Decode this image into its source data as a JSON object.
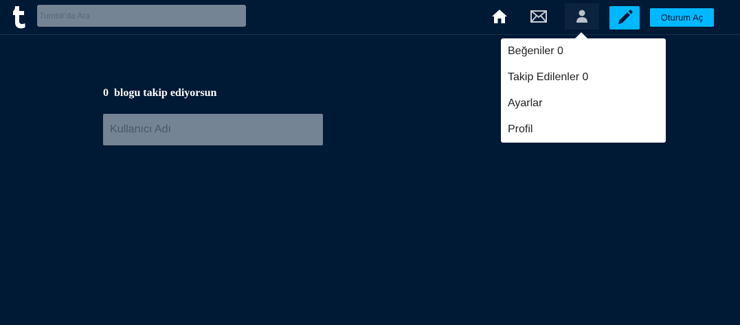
{
  "header": {
    "logo_icon": "tumblr-t-logo",
    "search": {
      "placeholder": "Tumblr'da Ara",
      "value": ""
    },
    "icons": {
      "home": "home-icon",
      "mail": "envelope-icon",
      "account": "person-icon",
      "compose": "pencil-icon"
    },
    "login_label": "Oturum Aç",
    "colors": {
      "accent": "#00b8ff",
      "background": "#001935",
      "field": "#748495"
    }
  },
  "account_menu": {
    "items": [
      {
        "label": "Beğeniler 0"
      },
      {
        "label": "Takip Edilenler 0"
      },
      {
        "label": "Ayarlar"
      },
      {
        "label": "Profil"
      }
    ]
  },
  "main": {
    "follow_count": "0",
    "follow_text": "blogu takip ediyorsun",
    "username_field": {
      "placeholder": "Kullanıcı Adı",
      "value": ""
    }
  }
}
